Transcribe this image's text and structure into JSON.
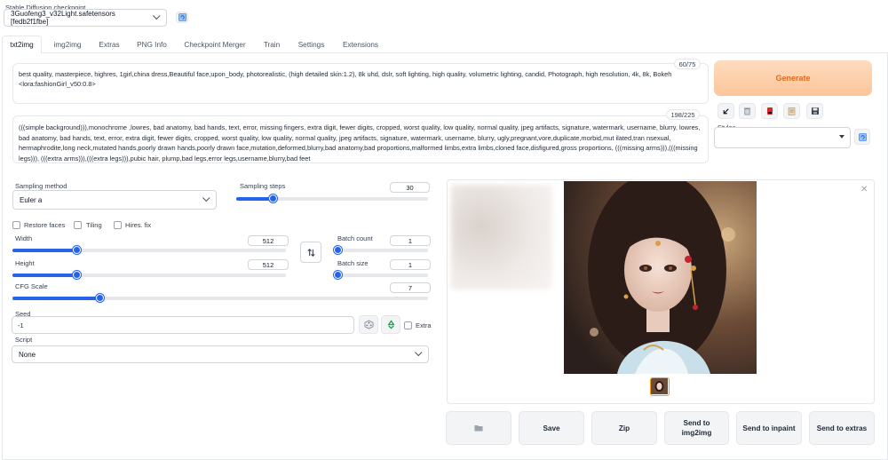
{
  "checkpoint": {
    "label": "Stable Diffusion checkpoint",
    "value": "3Guofeng3_v32Light.safetensors [fedb2f1fbe]"
  },
  "tabs": [
    "txt2img",
    "img2img",
    "Extras",
    "PNG Info",
    "Checkpoint Merger",
    "Train",
    "Settings",
    "Extensions"
  ],
  "active_tab": "txt2img",
  "prompt": {
    "text": "best quality, masterpiece, highres, 1girl,china dress,Beautiful face,upon_body, photorealistic, (high detailed skin:1.2), 8k uhd, dslr, soft lighting, high quality, volumetric lighting, candid, Photograph, high resolution, 4k, 8k, Bokeh <lora:fashionGirl_v50:0.8>",
    "counter": "60/75"
  },
  "negative_prompt": {
    "text": "(((simple background))),monochrome ,lowres, bad anatomy, bad hands, text, error, missing fingers, extra digit, fewer digits, cropped, worst quality, low quality, normal quality, jpeg artifacts, signature, watermark, username, blurry, lowres, bad anatomy, bad hands, text, error, extra digit, fewer digits, cropped, worst quality, low quality, normal quality, jpeg artifacts, signature, watermark, username, blurry, ugly,pregnant,vore,duplicate,morbid,mut ilated,tran nsexual, hermaphrodite,long neck,mutated hands,poorly drawn hands,poorly drawn face,mutation,deformed,blurry,bad anatomy,bad proportions,malformed limbs,extra limbs,cloned face,disfigured,gross proportions, (((missing arms))),(((missing legs))), (((extra arms))),(((extra legs))),pubic hair, plump,bad legs,error legs,username,blurry,bad feet",
    "counter": "198/225"
  },
  "generate_label": "Generate",
  "styles": {
    "label": "Styles",
    "value": ""
  },
  "sampling": {
    "method_label": "Sampling method",
    "method_value": "Euler a",
    "steps_label": "Sampling steps",
    "steps_value": "30",
    "steps_fraction": 0.19
  },
  "checkboxes": {
    "restore_faces": "Restore faces",
    "tiling": "Tiling",
    "hires_fix": "Hires. fix",
    "extra": "Extra"
  },
  "width": {
    "label": "Width",
    "value": "512",
    "fraction": 0.235
  },
  "height": {
    "label": "Height",
    "value": "512",
    "fraction": 0.235
  },
  "batch_count": {
    "label": "Batch count",
    "value": "1",
    "fraction": 0.0
  },
  "batch_size": {
    "label": "Batch size",
    "value": "1",
    "fraction": 0.0
  },
  "cfg": {
    "label": "CFG Scale",
    "value": "7",
    "fraction": 0.21
  },
  "seed": {
    "label": "Seed",
    "value": "-1"
  },
  "script": {
    "label": "Script",
    "value": "None"
  },
  "output_buttons": {
    "folder": "",
    "save": "Save",
    "zip": "Zip",
    "send_img2img": "Send to img2img",
    "send_inpaint": "Send to inpaint",
    "send_extras": "Send to extras"
  },
  "colors": {
    "accent": "#2563eb",
    "generate_bg": "#fcc599",
    "generate_text": "#e36a1b"
  }
}
